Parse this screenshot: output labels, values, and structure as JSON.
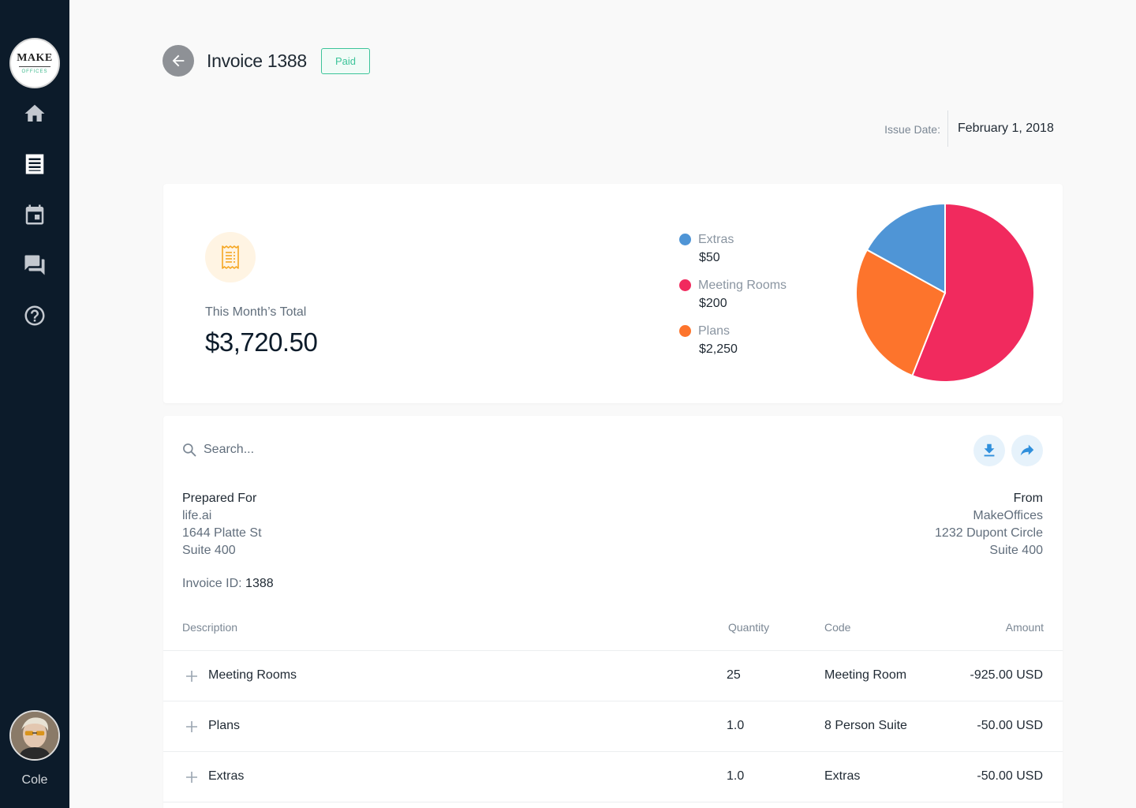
{
  "sidebar": {
    "logo": {
      "top": "MAKE",
      "bottom": "OFFICES"
    },
    "nav": [
      {
        "name": "home",
        "icon": "home-icon"
      },
      {
        "name": "invoices",
        "icon": "receipt-icon"
      },
      {
        "name": "calendar",
        "icon": "calendar-icon"
      },
      {
        "name": "messages",
        "icon": "chat-icon"
      },
      {
        "name": "help",
        "icon": "help-icon"
      }
    ],
    "user": {
      "name": "Cole"
    },
    "colors": {
      "background": "#0c1b2a",
      "icon": "#c3c8cf",
      "icon_active": "#ffffff"
    }
  },
  "header": {
    "title": "Invoice 1388",
    "status": "Paid",
    "issue_date_label": "Issue Date:",
    "issue_date": "February 1, 2018"
  },
  "summary": {
    "total_label": "This Month’s Total",
    "total_value": "$3,720.50",
    "legend": [
      {
        "name": "Extras",
        "amount": "$50",
        "color": "#4f95d6"
      },
      {
        "name": "Meeting Rooms",
        "amount": "$200",
        "color": "#f12a5e"
      },
      {
        "name": "Plans",
        "amount": "$2,250",
        "color": "#fd742c"
      }
    ]
  },
  "chart_data": {
    "type": "pie",
    "categories": [
      "Extras",
      "Meeting Rooms",
      "Plans"
    ],
    "values": [
      17,
      56,
      27
    ],
    "colors": [
      "#4f95d6",
      "#f12a5e",
      "#fd742c"
    ],
    "title": "",
    "legend_position": "left"
  },
  "detail": {
    "search_placeholder": "Search...",
    "prepared_for": {
      "heading": "Prepared For",
      "lines": [
        "life.ai",
        "1644 Platte St",
        "Suite 400"
      ]
    },
    "from": {
      "heading": "From",
      "lines": [
        "MakeOffices",
        "1232 Dupont Circle",
        "Suite 400"
      ]
    },
    "invoice_id_label": "Invoice ID:",
    "invoice_id": "1388",
    "table": {
      "columns": [
        "Description",
        "Quantity",
        "Code",
        "Amount"
      ],
      "rows": [
        {
          "description": "Meeting Rooms",
          "quantity": "25",
          "code": "Meeting Room",
          "amount": "-925.00 USD"
        },
        {
          "description": "Plans",
          "quantity": "1.0",
          "code": "8 Person Suite",
          "amount": "-50.00 USD"
        },
        {
          "description": "Extras",
          "quantity": "1.0",
          "code": "Extras",
          "amount": "-50.00 USD"
        }
      ]
    }
  }
}
